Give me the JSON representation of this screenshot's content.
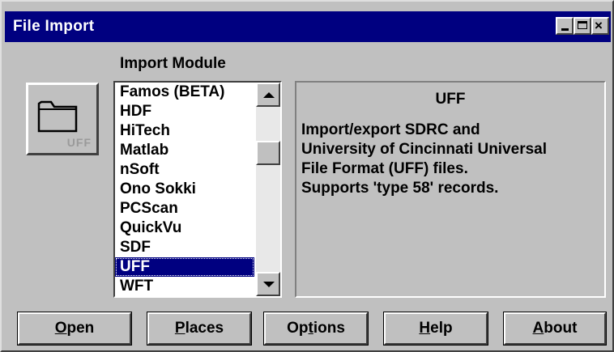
{
  "window": {
    "title": "File Import"
  },
  "title_buttons": {
    "minimize_icon": "minimize-icon",
    "maximize_icon": "maximize-icon",
    "close_icon": "close-icon",
    "close_glyph": "×"
  },
  "import_module": {
    "label": "Import Module",
    "icon": "folder-icon",
    "icon_caption": "UFF",
    "items": [
      "Famos (BETA)",
      "HDF",
      "HiTech",
      "Matlab",
      "nSoft",
      "Ono Sokki",
      "PCScan",
      "QuickVu",
      "SDF",
      "UFF",
      "WFT"
    ],
    "selected": "UFF"
  },
  "description": {
    "title": "UFF",
    "lines": [
      "Import/export SDRC and",
      "University of Cincinnati Universal",
      "File Format (UFF) files.",
      "Supports 'type 58' records."
    ]
  },
  "buttons": {
    "open": {
      "mnemonic": "O",
      "rest": "pen"
    },
    "places": {
      "mnemonic": "P",
      "rest": "laces"
    },
    "options": {
      "before": "Op",
      "mnemonic": "t",
      "rest": "ions"
    },
    "help": {
      "mnemonic": "H",
      "rest": "elp"
    },
    "about": {
      "mnemonic": "A",
      "rest": "bout"
    }
  },
  "colors": {
    "face": "#c0c0c0",
    "titlebar": "#000080",
    "selection": "#000080"
  }
}
